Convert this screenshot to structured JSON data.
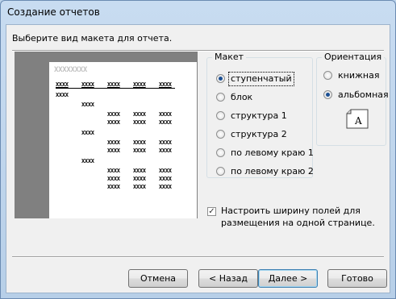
{
  "window": {
    "title": "Создание отчетов"
  },
  "prompt": "Выберите вид макета для отчета.",
  "preview": {
    "header_placeholder": "XXXXXXXX",
    "column_headers": [
      "XXXX",
      "XXXX",
      "XXXX",
      "XXXX",
      "XXXX"
    ],
    "group_label": "XXXX",
    "subgroup_label": "XXXX",
    "detail_cell": "XXXX"
  },
  "layout_group": {
    "title": "Макет",
    "options": [
      {
        "label": "ступенчатый",
        "selected": true
      },
      {
        "label": "блок",
        "selected": false
      },
      {
        "label": "структура 1",
        "selected": false
      },
      {
        "label": "структура 2",
        "selected": false
      },
      {
        "label": "по левому краю 1",
        "selected": false
      },
      {
        "label": "по левому краю 2",
        "selected": false
      }
    ]
  },
  "orientation_group": {
    "title": "Ориентация",
    "options": [
      {
        "label": "книжная",
        "selected": false
      },
      {
        "label": "альбомная",
        "selected": true
      }
    ],
    "page_icon_letter": "A"
  },
  "fit_checkbox": {
    "checked": true,
    "label_line1": "Настроить ширину полей для",
    "label_line2": "размещения на одной странице."
  },
  "buttons": {
    "cancel": "Отмена",
    "back": "< Назад",
    "next": "Далее >",
    "finish": "Готово"
  }
}
